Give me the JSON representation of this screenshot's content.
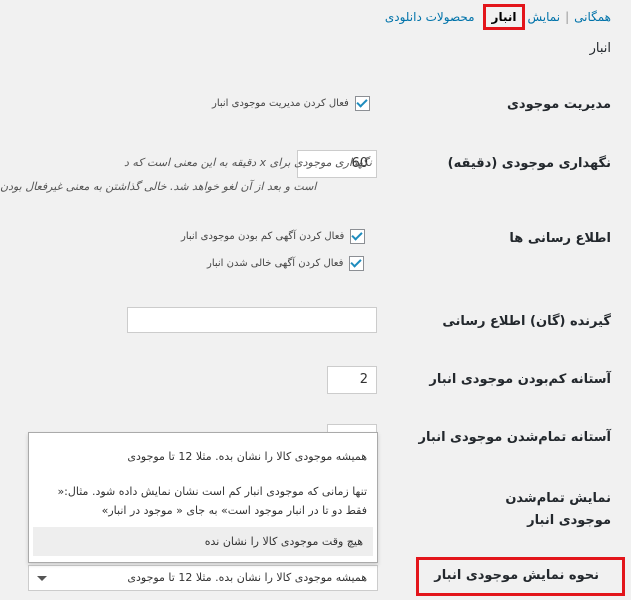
{
  "nav": {
    "all": "همگانی",
    "display": "نمایش",
    "inventory": "انبار",
    "downloadable": "محصولات دانلودی",
    "sep": "|"
  },
  "section_title": "انبار",
  "fields": {
    "manage_stock": {
      "label": "مدیریت موجودی",
      "checkbox_label": "فعال کردن مدیریت موجودی انبار",
      "checked": true
    },
    "hold_stock": {
      "label": "نگهداری موجودی (دقیقه)",
      "value": "60",
      "desc_line1": "نگهداری موجودی برای x دقیقه به این معنی است که د",
      "desc_line2": "است و بعد از آن لغو خواهد شد. خالی گذاشتن به معنی غیرفعال بودن"
    },
    "notifications": {
      "label": "اطلاع رسانی ها",
      "low_stock_label": "فعال کردن آگهی کم بودن موجودی انبار",
      "low_stock_checked": true,
      "out_of_stock_label": "فعال کردن آگهی خالی شدن انبار",
      "out_of_stock_checked": true
    },
    "recipient": {
      "label": "گیرنده (گان) اطلاع رسانی",
      "value": ""
    },
    "low_threshold": {
      "label": "آستانه کم‌بودن موجودی انبار",
      "value": "2"
    },
    "out_threshold": {
      "label": "آستانه تمام‌شدن موجودی انبار"
    },
    "out_visibility": {
      "label": "نمایش تمام‌شدن موجودی انبار"
    },
    "stock_format": {
      "label": "نحوه نمایش موجودی انبار",
      "selected": "همیشه موجودی کالا را نشان بده. مثلا 12 تا موجودی",
      "options": [
        "همیشه موجودی کالا را نشان بده. مثلا 12 تا موجودی",
        "تنها زمانی که موجودی انبار کم است نشان نمایش داده شود. مثال:« فقط دو تا در انبار موجود است» به جای « موجود در انبار»",
        "هیچ وقت موجودی کالا را نشان نده"
      ]
    }
  },
  "colors": {
    "accent": "#0073aa",
    "highlight_border": "#e3151b",
    "checkmark": "#1e8cbe"
  }
}
